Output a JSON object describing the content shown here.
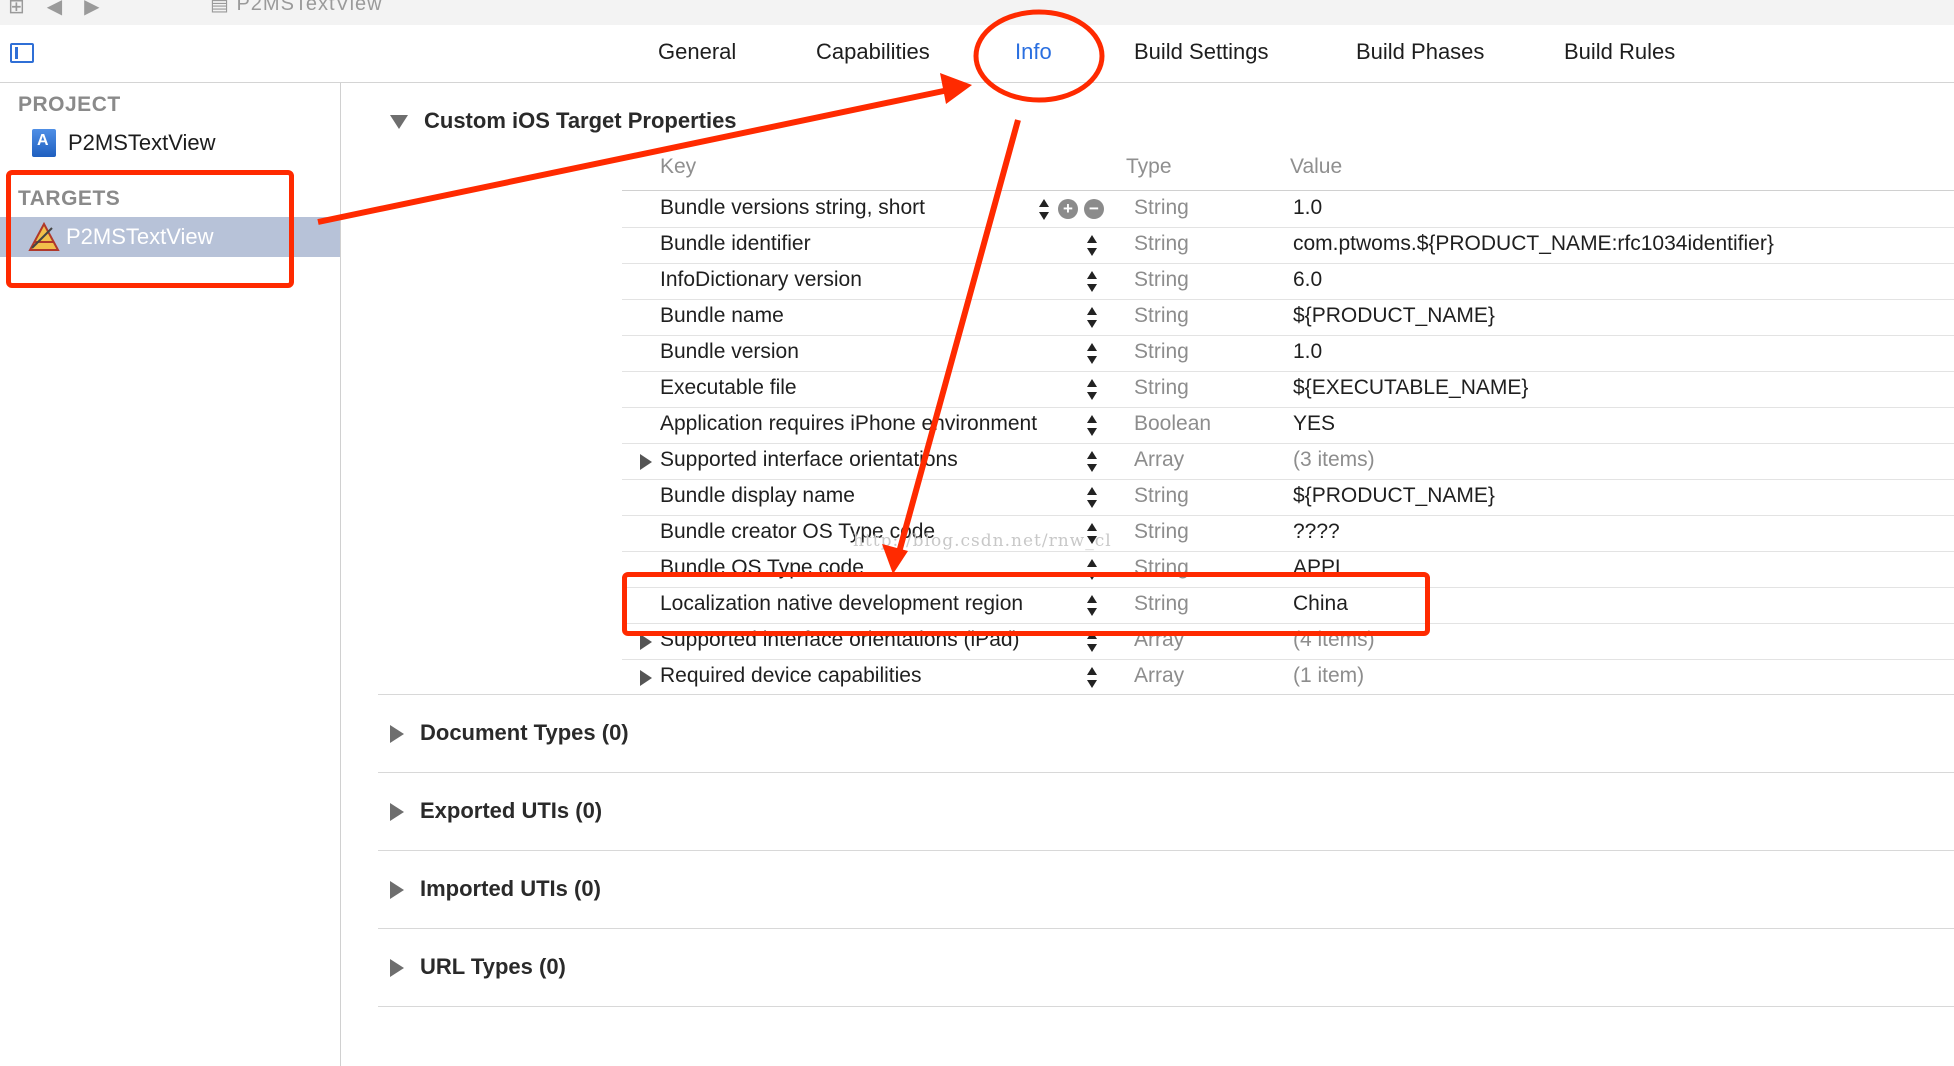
{
  "breadcrumb": {
    "project_name": "P2MSTextView"
  },
  "tabs": [
    {
      "label": "General",
      "active": false
    },
    {
      "label": "Capabilities",
      "active": false
    },
    {
      "label": "Info",
      "active": true
    },
    {
      "label": "Build Settings",
      "active": false
    },
    {
      "label": "Build Phases",
      "active": false
    },
    {
      "label": "Build Rules",
      "active": false
    }
  ],
  "sidebar": {
    "project_header": "PROJECT",
    "project_item": "P2MSTextView",
    "targets_header": "TARGETS",
    "target_item": "P2MSTextView"
  },
  "main": {
    "custom_section_title": "Custom iOS Target Properties",
    "columns": {
      "key": "Key",
      "type": "Type",
      "value": "Value"
    },
    "rows": [
      {
        "key": "Bundle versions string, short",
        "type": "String",
        "value": "1.0"
      },
      {
        "key": "Bundle identifier",
        "type": "String",
        "value": "com.ptwoms.${PRODUCT_NAME:rfc1034identifier}"
      },
      {
        "key": "InfoDictionary version",
        "type": "String",
        "value": "6.0"
      },
      {
        "key": "Bundle name",
        "type": "String",
        "value": "${PRODUCT_NAME}"
      },
      {
        "key": "Bundle version",
        "type": "String",
        "value": "1.0"
      },
      {
        "key": "Executable file",
        "type": "String",
        "value": "${EXECUTABLE_NAME}"
      },
      {
        "key": "Application requires iPhone environment",
        "type": "Boolean",
        "value": "YES"
      },
      {
        "key": "Supported interface orientations",
        "type": "Array",
        "value": "(3 items)"
      },
      {
        "key": "Bundle display name",
        "type": "String",
        "value": "${PRODUCT_NAME}"
      },
      {
        "key": "Bundle creator OS Type code",
        "type": "String",
        "value": "????"
      },
      {
        "key": "Bundle OS Type code",
        "type": "String",
        "value": "APPL"
      },
      {
        "key": "Localization native development region",
        "type": "String",
        "value": "China"
      },
      {
        "key": "Supported interface orientations (iPad)",
        "type": "Array",
        "value": "(4 items)"
      },
      {
        "key": "Required device capabilities",
        "type": "Array",
        "value": "(1 item)"
      }
    ],
    "row_buttons": {
      "add": "+",
      "remove": "−"
    },
    "watermark": "http://blog.csdn.net/rnw_cl",
    "collapsed_sections": [
      "Document Types (0)",
      "Exported UTIs (0)",
      "Imported UTIs (0)",
      "URL Types (0)"
    ]
  },
  "colors": {
    "accent_blue": "#2a6fe0",
    "annotation_red": "#ff2a00",
    "selection": "#b7c2d8"
  }
}
